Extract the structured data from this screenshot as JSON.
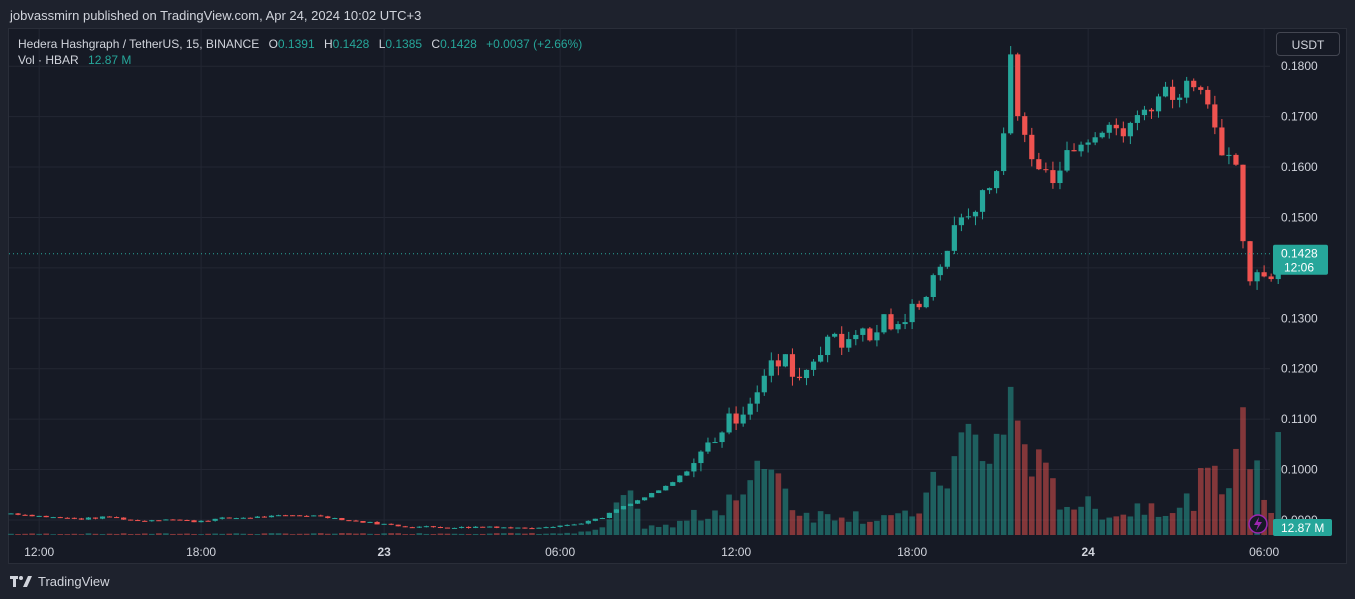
{
  "header": {
    "published_line": "jobvassmirn published on TradingView.com, Apr 24, 2024 10:02 UTC+3"
  },
  "legend": {
    "symbol": "Hedera Hashgraph / TetherUS, 15, BINANCE",
    "open_label": "O",
    "open": "0.1391",
    "high_label": "H",
    "high": "0.1428",
    "low_label": "L",
    "low": "0.1385",
    "close_label": "C",
    "close": "0.1428",
    "change": "+0.0037 (+2.66%)",
    "vol_label": "Vol · HBAR",
    "vol_value": "12.87 M"
  },
  "toolbar": {
    "currency": "USDT"
  },
  "footer": {
    "brand": "TradingView",
    "logo_icon": "tradingview-logo-icon"
  },
  "colors": {
    "up": "#26a69a",
    "down": "#ef5350",
    "background": "#161a25",
    "grid": "#232733",
    "text": "#d1d4dc"
  },
  "chart_data": {
    "type": "candlestick",
    "symbol": "HBARUSDT",
    "interval": "15",
    "exchange": "BINANCE",
    "y_ticks": [
      "0.1800",
      "0.1700",
      "0.1600",
      "0.1500",
      "0.1400",
      "0.1300",
      "0.1200",
      "0.1100",
      "0.1000",
      "0.0900"
    ],
    "ylim": [
      0.0886,
      0.1846
    ],
    "x_ticks": [
      "12:00",
      "18:00",
      "23",
      "06:00",
      "12:00",
      "18:00",
      "24",
      "06:00"
    ],
    "bold_x_ticks": [
      "23",
      "24"
    ],
    "last_price_label": "0.1428",
    "countdown": "12:06",
    "last_volume_label": "12.87 M",
    "close_path": [
      [
        0,
        0.0913
      ],
      [
        6,
        0.0905
      ],
      [
        10,
        0.0902
      ],
      [
        14,
        0.0906
      ],
      [
        18,
        0.0898
      ],
      [
        22,
        0.0902
      ],
      [
        26,
        0.0897
      ],
      [
        30,
        0.0903
      ],
      [
        34,
        0.0905
      ],
      [
        40,
        0.0909
      ],
      [
        44,
        0.0908
      ],
      [
        48,
        0.0899
      ],
      [
        52,
        0.0893
      ],
      [
        56,
        0.0887
      ],
      [
        60,
        0.0886
      ],
      [
        64,
        0.0885
      ],
      [
        68,
        0.0887
      ],
      [
        72,
        0.0884
      ],
      [
        76,
        0.0887
      ],
      [
        80,
        0.0891
      ],
      [
        84,
        0.0904
      ],
      [
        86,
        0.0921
      ],
      [
        88,
        0.0932
      ],
      [
        90,
        0.0945
      ],
      [
        92,
        0.0958
      ],
      [
        94,
        0.0975
      ],
      [
        96,
        0.0998
      ],
      [
        98,
        0.103
      ],
      [
        100,
        0.1065
      ],
      [
        102,
        0.1095
      ],
      [
        104,
        0.112
      ],
      [
        106,
        0.116
      ],
      [
        108,
        0.1205
      ],
      [
        110,
        0.1215
      ],
      [
        112,
        0.1182
      ],
      [
        114,
        0.122
      ],
      [
        116,
        0.1265
      ],
      [
        118,
        0.1245
      ],
      [
        120,
        0.128
      ],
      [
        122,
        0.1255
      ],
      [
        124,
        0.13
      ],
      [
        126,
        0.1275
      ],
      [
        128,
        0.1318
      ],
      [
        130,
        0.1355
      ],
      [
        132,
        0.141
      ],
      [
        134,
        0.147
      ],
      [
        136,
        0.151
      ],
      [
        138,
        0.1538
      ],
      [
        140,
        0.159
      ],
      [
        141,
        0.168
      ],
      [
        142,
        0.1812
      ],
      [
        143,
        0.17
      ],
      [
        144,
        0.166
      ],
      [
        146,
        0.16
      ],
      [
        148,
        0.157
      ],
      [
        150,
        0.162
      ],
      [
        152,
        0.166
      ],
      [
        154,
        0.1648
      ],
      [
        156,
        0.1685
      ],
      [
        158,
        0.167
      ],
      [
        160,
        0.17
      ],
      [
        162,
        0.1728
      ],
      [
        164,
        0.1755
      ],
      [
        166,
        0.174
      ],
      [
        168,
        0.177
      ],
      [
        170,
        0.1712
      ],
      [
        172,
        0.164
      ],
      [
        174,
        0.16
      ],
      [
        175,
        0.146
      ],
      [
        176,
        0.137
      ],
      [
        177,
        0.1385
      ],
      [
        178,
        0.14
      ],
      [
        179,
        0.1391
      ],
      [
        180,
        0.1428
      ]
    ],
    "volume_path": [
      [
        0,
        0.15
      ],
      [
        80,
        0.2
      ],
      [
        84,
        0.7
      ],
      [
        86,
        3.5
      ],
      [
        88,
        4.0
      ],
      [
        90,
        1.2
      ],
      [
        94,
        1.0
      ],
      [
        96,
        2.0
      ],
      [
        98,
        2.5
      ],
      [
        100,
        3.0
      ],
      [
        102,
        5.0
      ],
      [
        104,
        4.5
      ],
      [
        106,
        7.0
      ],
      [
        108,
        11.0
      ],
      [
        110,
        5.5
      ],
      [
        112,
        3.0
      ],
      [
        114,
        2.5
      ],
      [
        116,
        2.5
      ],
      [
        118,
        2.8
      ],
      [
        120,
        2.5
      ],
      [
        122,
        2.0
      ],
      [
        124,
        2.5
      ],
      [
        126,
        2.0
      ],
      [
        128,
        2.5
      ],
      [
        130,
        4.5
      ],
      [
        132,
        7.0
      ],
      [
        134,
        9.0
      ],
      [
        136,
        13.0
      ],
      [
        138,
        8.5
      ],
      [
        140,
        12.0
      ],
      [
        142,
        15.5
      ],
      [
        144,
        12.5
      ],
      [
        146,
        8.0
      ],
      [
        148,
        5.5
      ],
      [
        150,
        4.0
      ],
      [
        152,
        4.0
      ],
      [
        154,
        3.0
      ],
      [
        156,
        3.0
      ],
      [
        158,
        2.5
      ],
      [
        160,
        3.5
      ],
      [
        162,
        4.0
      ],
      [
        164,
        3.5
      ],
      [
        166,
        3.0
      ],
      [
        168,
        5.0
      ],
      [
        170,
        7.0
      ],
      [
        172,
        6.0
      ],
      [
        174,
        12.0
      ],
      [
        176,
        11.5
      ],
      [
        177,
        8.0
      ],
      [
        178,
        5.5
      ],
      [
        179,
        3.2
      ],
      [
        180,
        12.87
      ]
    ]
  }
}
